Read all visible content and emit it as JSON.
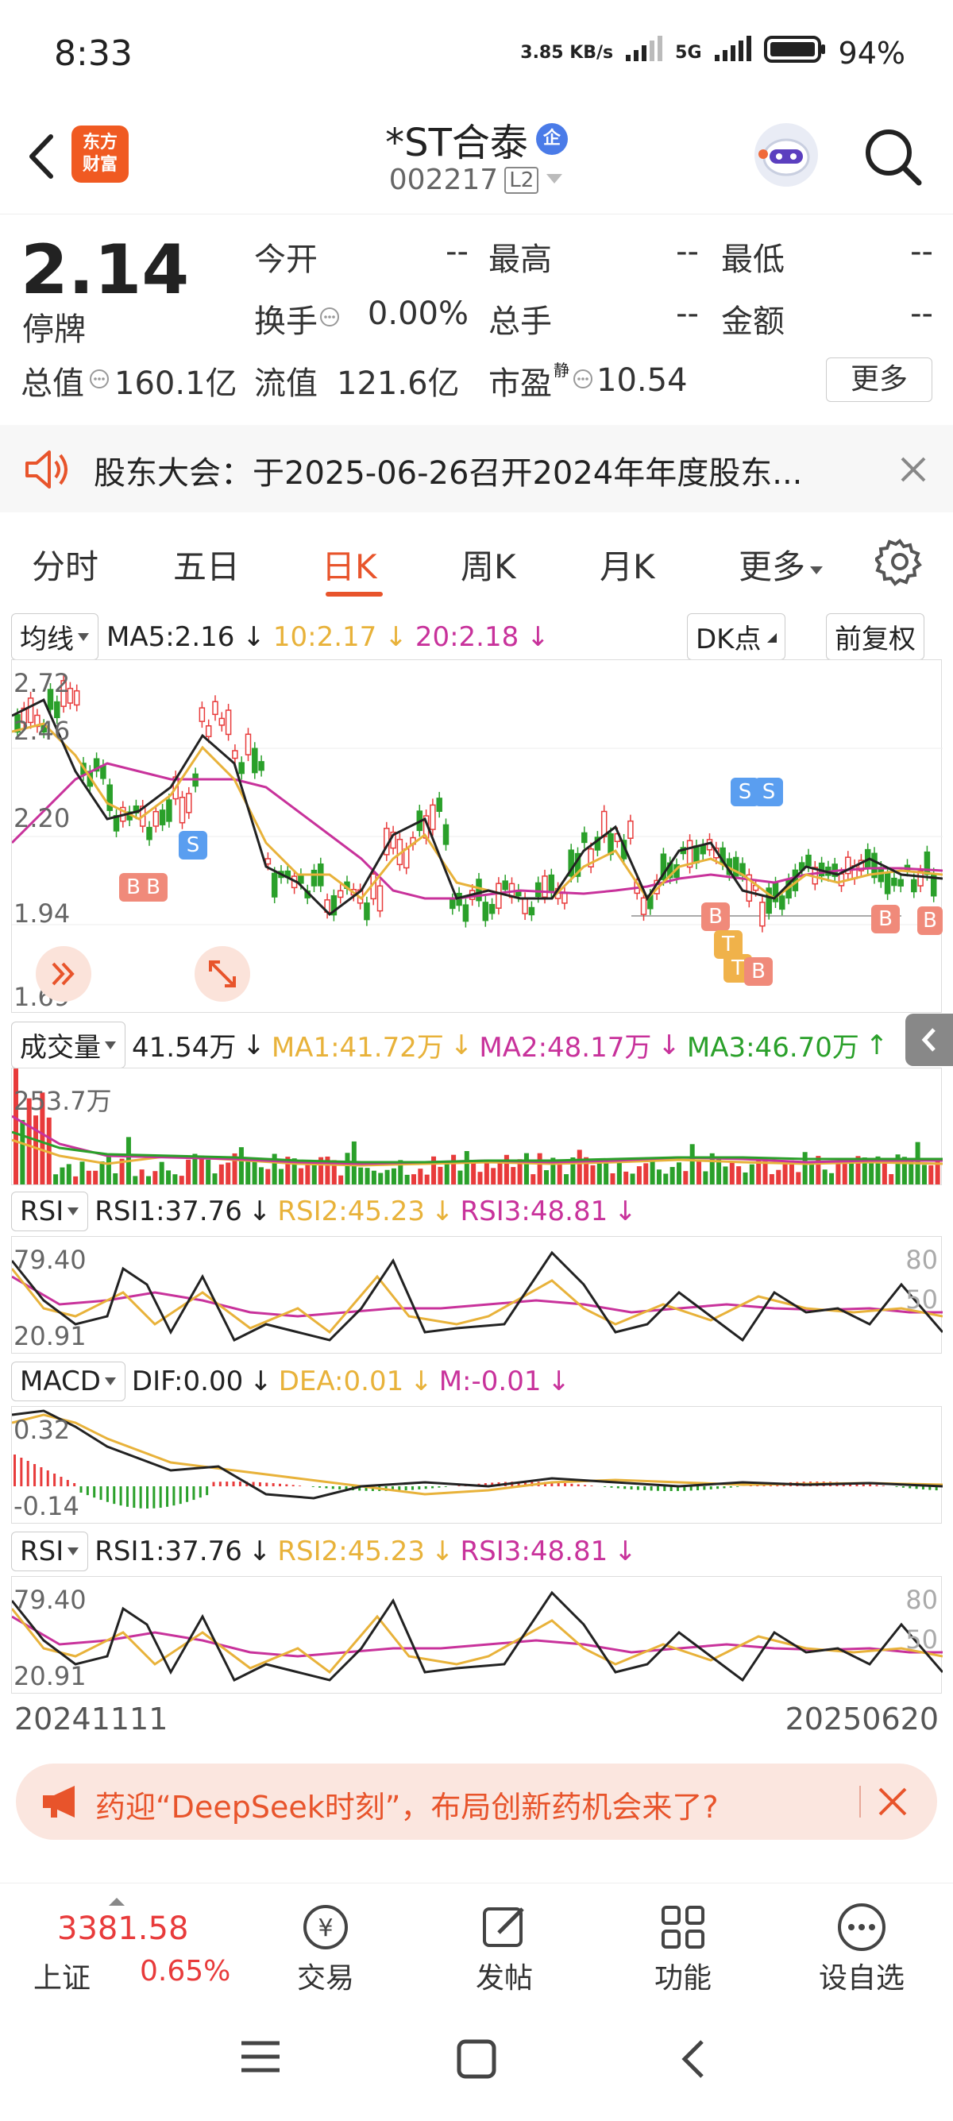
{
  "status_bar": {
    "time": "8:33",
    "net_speed": "3.85 KB/s",
    "net_type": "5G",
    "battery": "94%"
  },
  "header": {
    "logo_text": "东方\n财富",
    "stock_name": "*ST合泰",
    "stock_code": "002217",
    "level_badge": "L2",
    "enterprise_badge": "企"
  },
  "quote": {
    "price": "2.14",
    "status": "停牌",
    "fields": [
      {
        "label": "今开",
        "value": "--"
      },
      {
        "label": "最高",
        "value": "--"
      },
      {
        "label": "最低",
        "value": "--"
      },
      {
        "label": "换手",
        "value": "0.00%"
      },
      {
        "label": "总手",
        "value": "--"
      },
      {
        "label": "金额",
        "value": "--"
      }
    ],
    "total_value_label": "总值",
    "total_value": "160.1亿",
    "float_value_label": "流值",
    "float_value": "121.6亿",
    "pe_label": "市盈",
    "pe_superscript": "静",
    "pe_value": "10.54",
    "more_button": "更多"
  },
  "notice": {
    "text": "股东大会：于2025-06-26召开2024年年度股东..."
  },
  "tabs": [
    {
      "label": "分时"
    },
    {
      "label": "五日"
    },
    {
      "label": "日K"
    },
    {
      "label": "周K"
    },
    {
      "label": "月K"
    },
    {
      "label": "更多"
    }
  ],
  "kline": {
    "ma_selector": "均线",
    "ma5": "MA5:2.16",
    "ma10": "10:2.17",
    "ma20": "20:2.18",
    "dk_button": "DK点",
    "adjust_button": "前复权",
    "y_ticks": [
      "2.72",
      "2.46",
      "2.20",
      "1.94",
      "1.69"
    ],
    "colors": {
      "ma5": "#222222",
      "ma10": "#e8b23a",
      "ma20": "#c8329b",
      "up": "#e83b3b",
      "down": "#2aa02a"
    }
  },
  "volume": {
    "selector": "成交量",
    "value": "41.54万",
    "ma1": "MA1:41.72万",
    "ma2": "MA2:48.17万",
    "ma3": "MA3:46.70万",
    "max_label": "253.7万"
  },
  "rsi1": {
    "selector": "RSI",
    "rsi1": "RSI1:37.76",
    "rsi2": "RSI2:45.23",
    "rsi3": "RSI3:48.81",
    "top": "79.40",
    "bottom": "20.91",
    "level80": "80",
    "level50": "50"
  },
  "macd": {
    "selector": "MACD",
    "dif": "DIF:0.00",
    "dea": "DEA:0.01",
    "m": "M:-0.01",
    "top": "0.32",
    "bottom": "-0.14"
  },
  "rsi2": {
    "selector": "RSI",
    "rsi1": "RSI1:37.76",
    "rsi2": "RSI2:45.23",
    "rsi3": "RSI3:48.81",
    "top": "79.40",
    "bottom": "20.91",
    "level80": "80",
    "level50": "50"
  },
  "dates": {
    "start": "20241111",
    "end": "20250620"
  },
  "ad": {
    "text": "药迎“DeepSeek时刻”，布局创新药机会来了?"
  },
  "bottom_nav": {
    "index_value": "3381.58",
    "index_name": "上证",
    "index_change": "0.65%",
    "items": [
      {
        "label": "交易"
      },
      {
        "label": "发帖"
      },
      {
        "label": "功能"
      },
      {
        "label": "设自选"
      }
    ]
  }
}
